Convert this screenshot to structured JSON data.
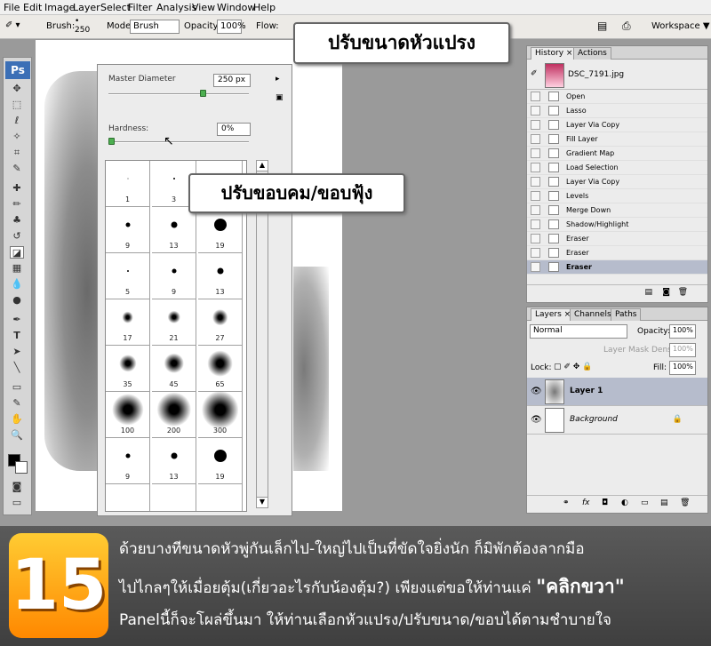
{
  "menubar": [
    "File",
    "Edit",
    "Image",
    "Layer",
    "Select",
    "Filter",
    "Analysis",
    "View",
    "Window",
    "Help"
  ],
  "options": {
    "brush_label": "Brush:",
    "brush_size": "250",
    "mode_label": "Mode:",
    "mode_value": "Brush",
    "opacity_label": "Opacity:",
    "opacity_value": "100%",
    "flow_label": "Flow:",
    "workspace": "Workspace ▼"
  },
  "brush_panel": {
    "master_diameter_label": "Master Diameter",
    "master_diameter_value": "250 px",
    "master_diameter_level": 0.68,
    "hardness_label": "Hardness:",
    "hardness_value": "0%",
    "hardness_level": 0.0,
    "presets": [
      [
        "1",
        "3",
        ""
      ],
      [
        "9",
        "13",
        "19"
      ],
      [
        "5",
        "9",
        "13"
      ],
      [
        "17",
        "21",
        "27"
      ],
      [
        "35",
        "45",
        "65"
      ],
      [
        "100",
        "200",
        "300"
      ],
      [
        "9",
        "13",
        "19"
      ],
      [
        "",
        "",
        ""
      ]
    ]
  },
  "callouts": {
    "size": "ปรับขนาดหัวแปรง",
    "hardness": "ปรับขอบคม/ขอบฟุ้ง"
  },
  "history": {
    "tabs": [
      "History ×",
      "Actions"
    ],
    "snapshot": "DSC_7191.jpg",
    "items": [
      "Open",
      "Lasso",
      "Layer Via Copy",
      "Fill Layer",
      "Gradient Map",
      "Load Selection",
      "Layer Via Copy",
      "Levels",
      "Merge Down",
      "Shadow/Highlight",
      "Eraser",
      "Eraser",
      "Eraser"
    ]
  },
  "layers": {
    "tabs": [
      "Layers ×",
      "Channels",
      "Paths"
    ],
    "blend": "Normal",
    "opacity_label": "Opacity:",
    "opacity_value": "100%",
    "mask_density_label": "Layer Mask Density:",
    "mask_density_value": "100%",
    "lock_label": "Lock:",
    "fill_label": "Fill:",
    "fill_value": "100%",
    "items": [
      {
        "name": "Layer 1"
      },
      {
        "name": "Background"
      }
    ]
  },
  "banner": {
    "step": "15",
    "line1": "ด้วยบางทีขนาดหัวพู่กันเล็กไป-ใหญ่ไปเป็นที่ขัดใจยิ่งนัก ก็มิพักต้องลากมือ",
    "line2a": "ไปไกลๆให้เมื่อยตุ้ม(เกี่ยวอะไรกับน้องตุ้ม?) เพียงแต่ขอให้ท่านแค่ ",
    "line2b": "\"คลิกขวา\"",
    "line3": "Panelนี้ก็จะโผล่ขึ้นมา ให้ท่านเลือกหัวแปรง/ปรับขนาด/ขอบได้ตามชำบายใจ"
  },
  "colors": {
    "accent": "#3b6fb6",
    "selected_row": "#b6bccc",
    "banner_num": "#ff9900"
  }
}
